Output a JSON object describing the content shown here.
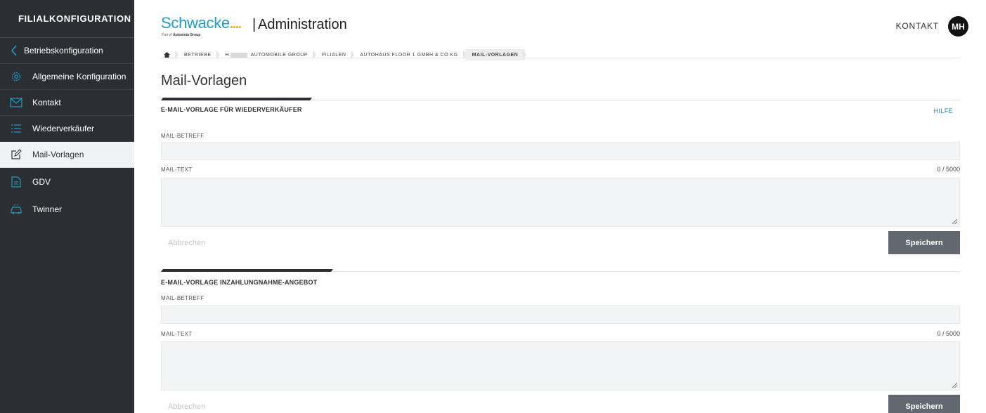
{
  "sidebar": {
    "header": "FILIALKONFIGURATION",
    "back_label": "Betriebskonfiguration",
    "items": [
      {
        "label": "Allgemeine Konfiguration",
        "icon": "gear-icon"
      },
      {
        "label": "Kontakt",
        "icon": "envelope-icon"
      },
      {
        "label": "Wiederverkäufer",
        "icon": "list-icon"
      },
      {
        "label": "Mail-Vorlagen",
        "icon": "edit-icon",
        "active": true
      },
      {
        "label": "GDV",
        "icon": "document-icon"
      },
      {
        "label": "Twinner",
        "icon": "car-icon"
      }
    ],
    "accent_color": "#1f9cc7"
  },
  "header": {
    "logo_text": "Schwacke",
    "logo_dots": "....",
    "logo_sub_prefix": "Part of ",
    "logo_sub_brand": "Autovista Group",
    "separator": "|",
    "app_title": "Administration",
    "contact_label": "KONTAKT",
    "avatar_initials": "MH"
  },
  "breadcrumb": {
    "items": [
      "BETRIEBE",
      "H",
      "AUTOMOBILE GROUP",
      "FILIALEN",
      "AUTOHAUS FLOOR 1 GMBH & CO KG",
      "MAIL-VORLAGEN"
    ]
  },
  "page": {
    "title": "Mail-Vorlagen"
  },
  "sections": [
    {
      "title": "E-MAIL-VORLAGE FÜR WIEDERVERKÄUFER",
      "help_label": "HILFE",
      "subject_label": "MAIL-BETREFF",
      "subject_value": "",
      "text_label": "MAIL-TEXT",
      "text_value": "",
      "counter": "0 / 5000",
      "cancel_label": "Abbrechen",
      "save_label": "Speichern"
    },
    {
      "title": "E-MAIL-VORLAGE INZAHLUNGNAHME-ANGEBOT",
      "subject_label": "MAIL-BETREFF",
      "subject_value": "",
      "text_label": "MAIL-TEXT",
      "text_value": "",
      "counter": "0 / 5000",
      "cancel_label": "Abbrechen",
      "save_label": "Speichern"
    }
  ]
}
